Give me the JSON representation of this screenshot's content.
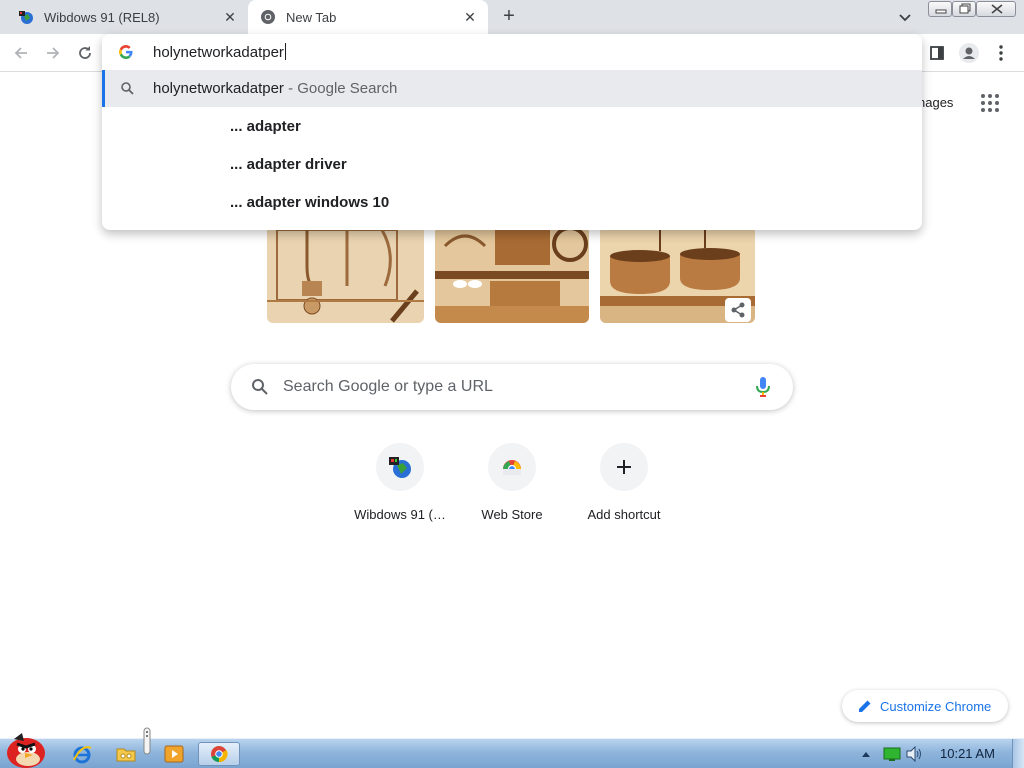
{
  "tabs": [
    {
      "title": "Wibdows 91 (REL8)",
      "active": false
    },
    {
      "title": "New Tab",
      "active": true
    }
  ],
  "omnibox": {
    "typed_text": "holynetworkadatper",
    "selected_suggestion": {
      "query": "holynetworkadatper",
      "suffix": " - Google Search"
    },
    "suggestions": [
      "... adapter",
      "... adapter driver",
      "... adapter windows 10"
    ]
  },
  "page": {
    "images_link": "nages",
    "search_placeholder": "Search Google or type a URL",
    "shortcuts": [
      {
        "label": "Wibdows 91 (…",
        "icon": "wibdows-favicon-icon"
      },
      {
        "label": "Web Store",
        "icon": "web-store-icon"
      },
      {
        "label": "Add shortcut",
        "icon": "plus-icon"
      }
    ],
    "customize_label": "Customize Chrome"
  },
  "taskbar": {
    "clock": "10:21 AM"
  },
  "colors": {
    "accent": "#1a73e8",
    "tabstrip": "#dee1e6",
    "selected_row": "#e8eaed",
    "taskbar": "#8fb5dc"
  }
}
